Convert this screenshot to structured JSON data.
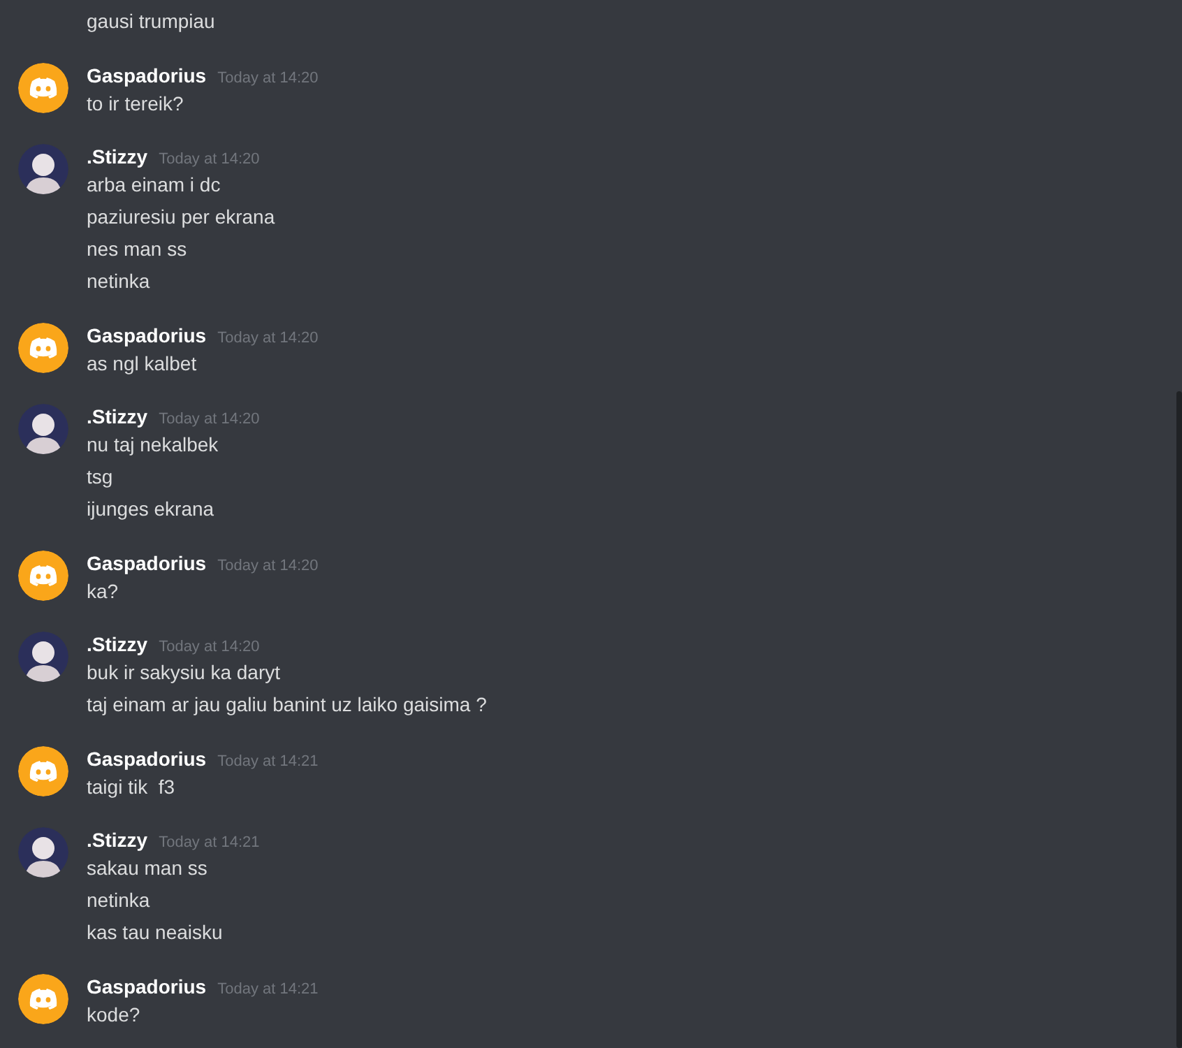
{
  "messages": [
    {
      "kind": "continuation",
      "lines": [
        "gausi trumpiau"
      ]
    },
    {
      "kind": "bot",
      "author": "Gaspadorius",
      "timestamp": "Today at 14:20",
      "lines": [
        "to ir tereik?"
      ]
    },
    {
      "kind": "user",
      "author": ".Stizzy",
      "timestamp": "Today at 14:20",
      "lines": [
        "arba einam i dc",
        "paziuresiu per ekrana",
        "nes man ss",
        "netinka"
      ]
    },
    {
      "kind": "bot",
      "author": "Gaspadorius",
      "timestamp": "Today at 14:20",
      "lines": [
        "as ngl kalbet"
      ]
    },
    {
      "kind": "user",
      "author": ".Stizzy",
      "timestamp": "Today at 14:20",
      "lines": [
        "nu taj nekalbek",
        "tsg",
        "ijunges ekrana"
      ]
    },
    {
      "kind": "bot",
      "author": "Gaspadorius",
      "timestamp": "Today at 14:20",
      "lines": [
        "ka?"
      ]
    },
    {
      "kind": "user",
      "author": ".Stizzy",
      "timestamp": "Today at 14:20",
      "lines": [
        "buk ir sakysiu ka daryt",
        "taj einam ar jau galiu banint uz laiko gaisima ?"
      ]
    },
    {
      "kind": "bot",
      "author": "Gaspadorius",
      "timestamp": "Today at 14:21",
      "lines": [
        "taigi tik  f3"
      ]
    },
    {
      "kind": "user",
      "author": ".Stizzy",
      "timestamp": "Today at 14:21",
      "lines": [
        "sakau man ss",
        "netinka",
        "kas tau neaisku"
      ]
    },
    {
      "kind": "bot",
      "author": "Gaspadorius",
      "timestamp": "Today at 14:21",
      "lines": [
        "kode?"
      ]
    }
  ]
}
